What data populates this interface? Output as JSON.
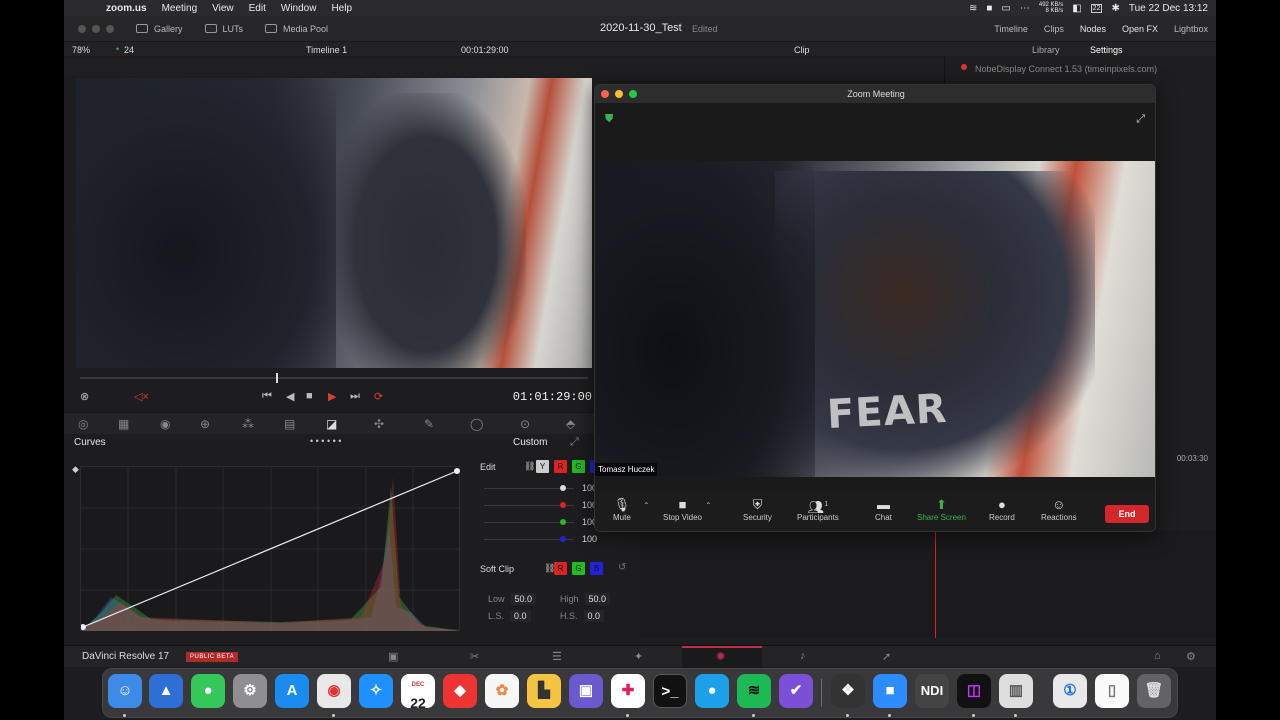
{
  "menubar": {
    "app": "zoom.us",
    "items": [
      "Meeting",
      "View",
      "Edit",
      "Window",
      "Help"
    ],
    "net_up": "492 KB/s",
    "net_down": "8 KB/s",
    "calendar_day": "22",
    "datetime": "Tue 22 Dec  13:12"
  },
  "resolve": {
    "top_items": [
      "Gallery",
      "LUTs",
      "Media Pool"
    ],
    "project_title": "2020-11-30_Test",
    "project_status": "Edited",
    "right_items": [
      "Timeline",
      "Clips",
      "Nodes",
      "Open FX",
      "Lightbox"
    ],
    "zoom_level": "78%",
    "fps": "24",
    "timeline_name": "Timeline 1",
    "timecode_top": "00:01:29:00",
    "clip_label": "Clip",
    "library_tab": "Library",
    "settings_tab": "Settings",
    "viewer_timecode": "01:01:29:00",
    "curves_label": "Curves",
    "curves_mode": "Custom",
    "edit_label": "Edit",
    "channel_chips": [
      "Y",
      "R",
      "G",
      "B"
    ],
    "channel_values": [
      "100",
      "100",
      "100",
      "100"
    ],
    "soft_clip_label": "Soft Clip",
    "low_label": "Low",
    "low_value": "50.0",
    "high_label": "High",
    "high_value": "50.0",
    "ls_label": "L.S.",
    "ls_value": "0.0",
    "hs_label": "H.S.",
    "hs_value": "0.0",
    "plugin_entry": "NobeDisplay Connect 1.53 (timeinpixels.com)",
    "timeline_tc": "00:03:30",
    "app_name": "DaVinci Resolve 17",
    "beta_badge": "PUBLIC BETA"
  },
  "zoom": {
    "window_title": "Zoom Meeting",
    "participant_name": "Tomasz Huczek",
    "shirt_text": "FEAR",
    "controls": [
      "Mute",
      "Stop Video",
      "Security",
      "Participants",
      "Chat",
      "Share Screen",
      "Record",
      "Reactions"
    ],
    "participant_count": "1",
    "end_label": "End"
  },
  "dock": {
    "calendar_month": "DEC",
    "calendar_day": "22"
  },
  "colors": {
    "accent_red": "#d3272d",
    "zoom_green": "#3bb54a",
    "resolve_bg": "#1d1d1f"
  }
}
